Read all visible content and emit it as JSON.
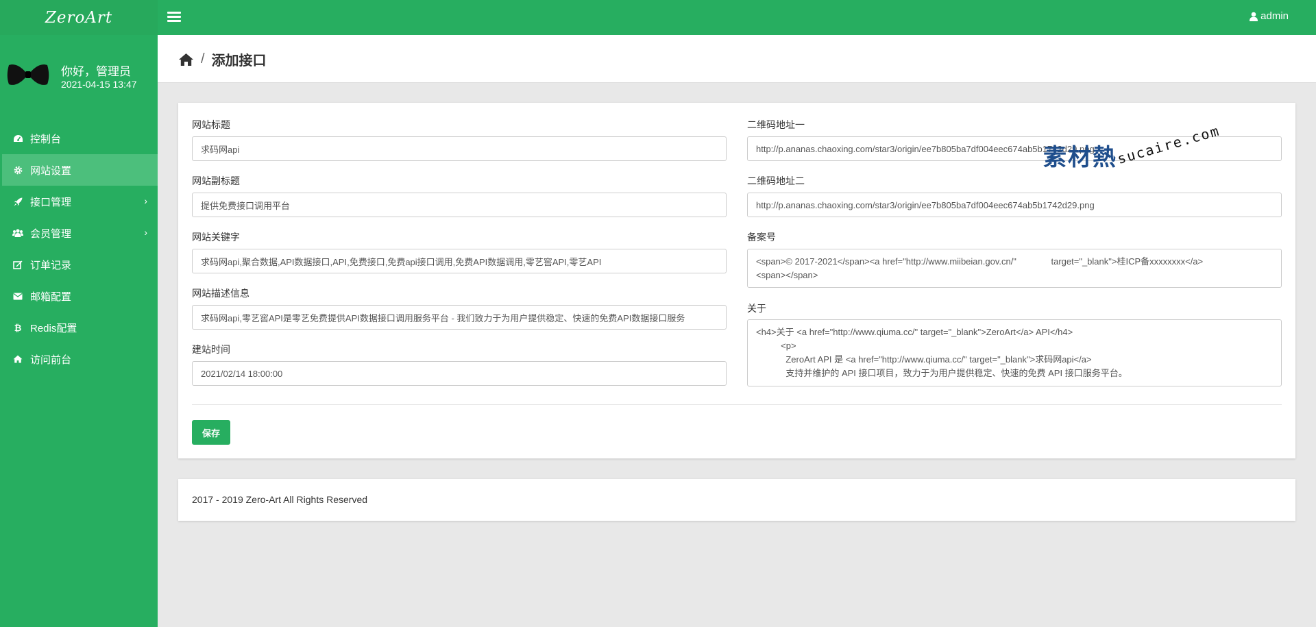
{
  "app": {
    "logo": "ZeroArt",
    "user": "admin"
  },
  "profile": {
    "greeting": "你好，管理员",
    "datetime": "2021-04-15 13:47"
  },
  "sidebar": {
    "items": [
      {
        "label": "控制台",
        "icon": "dashboard-icon"
      },
      {
        "label": "网站设置",
        "icon": "gear-icon",
        "active": true
      },
      {
        "label": "接口管理",
        "icon": "rocket-icon",
        "has_children": true
      },
      {
        "label": "会员管理",
        "icon": "users-icon",
        "has_children": true
      },
      {
        "label": "订单记录",
        "icon": "edit-icon"
      },
      {
        "label": "邮箱配置",
        "icon": "envelope-icon"
      },
      {
        "label": "Redis配置",
        "icon": "bitcoin-icon"
      },
      {
        "label": "访问前台",
        "icon": "home-icon"
      }
    ]
  },
  "breadcrumb": {
    "separator": "/",
    "title": "添加接口"
  },
  "form": {
    "site_title": {
      "label": "网站标题",
      "value": "求码网api"
    },
    "site_subtitle": {
      "label": "网站副标题",
      "value": "提供免费接口调用平台"
    },
    "keywords": {
      "label": "网站关键字",
      "value": "求码网api,聚合数据,API数据接口,API,免费接口,免费api接口调用,免费API数据调用,零艺窖API,零艺API"
    },
    "description": {
      "label": "网站描述信息",
      "value": "求码网api,零艺窖API是零艺免费提供API数据接口调用服务平台 - 我们致力于为用户提供稳定、快速的免费API数据接口服务"
    },
    "build_time": {
      "label": "建站时间",
      "value": "2021/02/14 18:00:00"
    },
    "qr1": {
      "label": "二维码地址一",
      "value": "http://p.ananas.chaoxing.com/star3/origin/ee7b805ba7df004eec674ab5b1742d29.png"
    },
    "qr2": {
      "label": "二维码地址二",
      "value": "http://p.ananas.chaoxing.com/star3/origin/ee7b805ba7df004eec674ab5b1742d29.png"
    },
    "icp": {
      "label": "备案号",
      "value": "<span>© 2017-2021</span><a href=\"http://www.miibeian.gov.cn/\"              target=\"_blank\">桂ICP备xxxxxxxx</a>\n<span></span>"
    },
    "about": {
      "label": "关于",
      "value": "<h4>关于 <a href=\"http://www.qiuma.cc/\" target=\"_blank\">ZeroArt</a> API</h4>\n          <p>\n            ZeroArt API 是 <a href=\"http://www.qiuma.cc/\" target=\"_blank\">求码网api</a>\n            支持并维护的 API 接口项目，致力于为用户提供稳定、快速的免费 API 接口服务平台。"
    },
    "save_label": "保存"
  },
  "footer": {
    "copyright": "2017 - 2019 Zero-Art All Rights Reserved"
  },
  "watermark": {
    "cn": "素材熱",
    "en": "sucaire.com"
  },
  "colors": {
    "brand": "#27ae60",
    "active_item": "#4cbf7c"
  }
}
